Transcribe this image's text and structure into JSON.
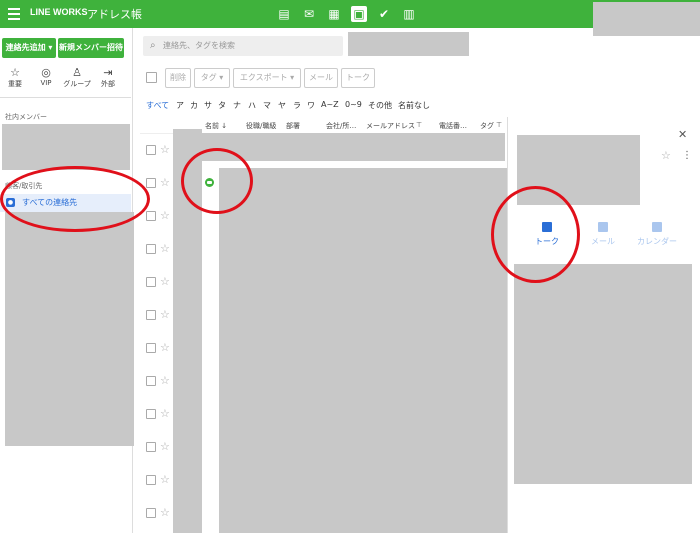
{
  "header": {
    "brand": "LINE WORKS",
    "title": "アドレス帳",
    "app_icons": [
      "board-icon",
      "talk-icon",
      "calendar-icon",
      "contacts-icon",
      "task-icon",
      "drive-icon"
    ]
  },
  "sidebar": {
    "add_contact_label": "連絡先追加 ▾",
    "invite_label": "新規メンバー招待",
    "categories": [
      {
        "icon": "star-icon",
        "label": "重要"
      },
      {
        "icon": "vip-icon",
        "label": "VIP"
      },
      {
        "icon": "group-icon",
        "label": "グループ"
      },
      {
        "icon": "external-icon",
        "label": "外部"
      }
    ],
    "internal_members_label": "社内メンバー",
    "customers_label": "顧客/取引先",
    "all_contacts_label": "すべての連絡先"
  },
  "search": {
    "placeholder": "連絡先、タグを検索"
  },
  "toolbar": {
    "delete_label": "削除",
    "tag_label": "タグ ▾",
    "export_label": "エクスポート ▾",
    "mail_label": "メール",
    "talk_label": "トーク"
  },
  "alphabet_filter": [
    "すべて",
    "ア",
    "カ",
    "サ",
    "タ",
    "ナ",
    "ハ",
    "マ",
    "ヤ",
    "ラ",
    "ワ",
    "A~Z",
    "0~9",
    "その他",
    "名前なし"
  ],
  "columns": [
    "名前 ↓",
    "役職/職級",
    "部署",
    "会社/所…",
    "メールアドレス",
    "電話番…",
    "タグ"
  ],
  "rows": 12,
  "detail_panel": {
    "close_label": "✕",
    "tabs": [
      {
        "icon": "talk-icon",
        "label": "トーク"
      },
      {
        "icon": "mail-icon",
        "label": "メール"
      },
      {
        "icon": "calendar-icon",
        "label": "カレンダー"
      }
    ]
  },
  "colors": {
    "brand": "#3fb23c",
    "accent": "#2a6ed6",
    "annotation": "#e0101a",
    "redaction": "#c8c8c8"
  }
}
